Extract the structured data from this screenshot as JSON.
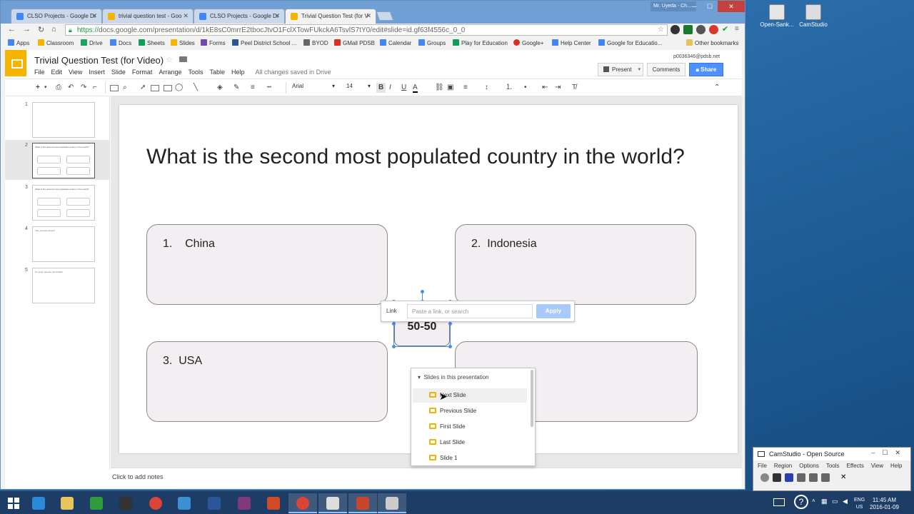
{
  "desktop": {
    "icons": [
      {
        "label": "Open-Sank...",
        "icon": "open-sankore-icon"
      },
      {
        "label": "CamStudio",
        "icon": "camstudio-icon"
      }
    ]
  },
  "browser": {
    "profile_name": "Mr. Uyeda - Ch...",
    "tabs": [
      {
        "title": "CLSO Projects - Google Dr",
        "icon": "drive-icon",
        "color": "#4285f4",
        "active": false
      },
      {
        "title": "trivial question test - Goo",
        "icon": "slides-icon",
        "color": "#f4b400",
        "active": false
      },
      {
        "title": "CLSO Projects - Google Dr",
        "icon": "drive-icon",
        "color": "#4285f4",
        "active": false
      },
      {
        "title": "Trivial Question Test (for V",
        "icon": "slides-icon",
        "color": "#f4b400",
        "active": true
      }
    ],
    "url_scheme": "https://",
    "url_rest": "docs.google.com/presentation/d/1kE8sC0mrrE2tbocJtvO1FclXTowFUkckA6TsvlS7tY0/edit#slide=id.gf63f4556c_0_0",
    "bookmarks": [
      "Apps",
      "Classroom",
      "Drive",
      "Docs",
      "Sheets",
      "Slides",
      "Forms",
      "Peel District School ...",
      "BYOD",
      "GMail PDSB",
      "Calendar",
      "Groups",
      "Play for Education",
      "Google+",
      "Help Center",
      "Google for Educatio..."
    ],
    "other_bookmarks": "Other bookmarks"
  },
  "slides_app": {
    "doc_title": "Trivial Question Test (for Video)",
    "menu": [
      "File",
      "Edit",
      "View",
      "Insert",
      "Slide",
      "Format",
      "Arrange",
      "Tools",
      "Table",
      "Help"
    ],
    "save_status": "All changes saved in Drive",
    "user_email": "p0036346@pdsb.net",
    "present_label": "Present",
    "comments_label": "Comments",
    "share_label": "Share",
    "toolbar": {
      "font": "Arial",
      "font_size": "14",
      "bold": "B",
      "italic": "I",
      "underline": "U",
      "text_color": "A"
    },
    "filmstrip": [
      {
        "num": "1",
        "text": ""
      },
      {
        "num": "2",
        "text": "What is the second most populated country in the world?"
      },
      {
        "num": "3",
        "text": "What is the second most populated country in the world?"
      },
      {
        "num": "4",
        "text": "Yes, you are correct!"
      },
      {
        "num": "5",
        "text": "I'm sorry, you are not correct!"
      }
    ],
    "slide": {
      "question": "What is the second most populated country in the world?",
      "answers": [
        {
          "number": "1.",
          "text": "China"
        },
        {
          "number": "2.",
          "text": "Indonesia"
        },
        {
          "number": "3.",
          "text": "USA"
        }
      ],
      "lifeline": "50-50"
    },
    "link_popup": {
      "label": "Link",
      "placeholder": "Paste a link, or search",
      "apply_label": "Apply",
      "section_header": "Slides in this presentation",
      "items": [
        "Next Slide",
        "Previous Slide",
        "First Slide",
        "Last Slide",
        "Slide 1"
      ]
    },
    "notes_placeholder": "Click to add notes"
  },
  "camstudio": {
    "title": "CamStudio - Open Source",
    "menu": [
      "File",
      "Region",
      "Options",
      "Tools",
      "Effects",
      "View",
      "Help"
    ]
  },
  "taskbar": {
    "language": "ENG",
    "region": "US",
    "time": "11:45 AM",
    "date": "2016-01-09"
  }
}
